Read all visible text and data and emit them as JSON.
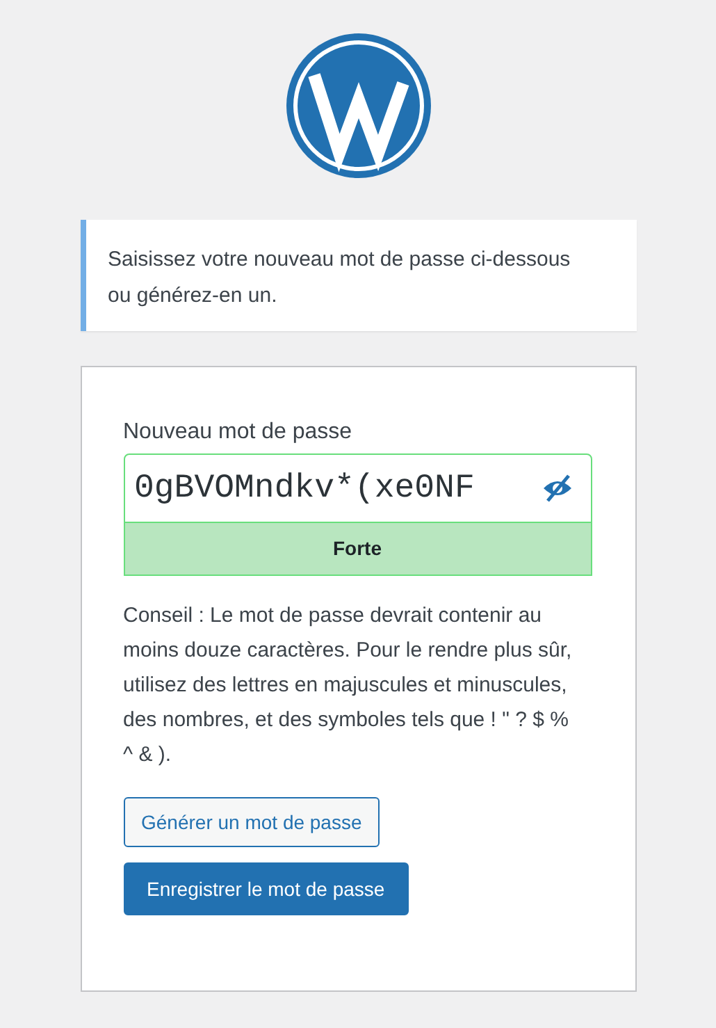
{
  "message": "Saisissez votre nouveau mot de passe ci-dessous ou générez-en un.",
  "form": {
    "label": "Nouveau mot de passe",
    "password": "0gBVOMndkv*(xe0NF",
    "visible": true,
    "strength": {
      "kind": "strong",
      "label": "Forte"
    },
    "hint": "Conseil : Le mot de passe devrait contenir au moins douze caractères. Pour le rendre plus sûr, utilisez des lettres en majuscules et minuscules, des nombres, et des symboles tels que ! \" ? $ % ^ & ).",
    "generate_button": "Générer un mot de passe",
    "save_button": "Enregistrer le mot de passe"
  }
}
